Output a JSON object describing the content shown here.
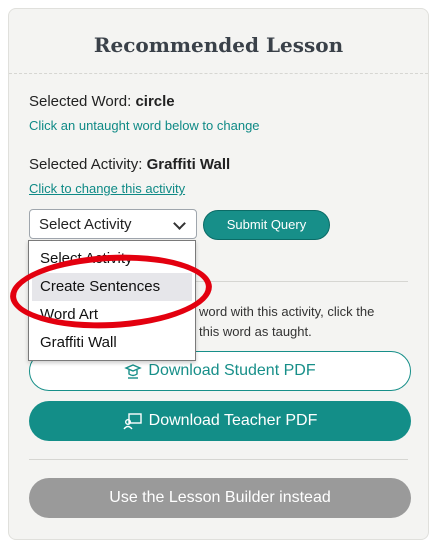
{
  "card": {
    "title": "Recommended Lesson",
    "selected_word_label": "Selected Word: ",
    "selected_word_value": "circle",
    "change_word_link": "Click an untaught word below to change",
    "selected_activity_label": "Selected Activity: ",
    "selected_activity_value": "Graffiti Wall",
    "change_activity_link": "Click to change this activity",
    "select_value": "Select Activity",
    "submit_label": "Submit Query",
    "help_line1": "word with this activity, click the",
    "help_line2": "this word as taught.",
    "download_student": "Download Student PDF",
    "download_teacher": "Download Teacher PDF",
    "lesson_builder": "Use the Lesson Builder instead"
  },
  "dropdown": {
    "options": [
      "Select Activity",
      "Create Sentences",
      "Word Art",
      "Graffiti Wall"
    ],
    "highlighted": "Create Sentences"
  },
  "colors": {
    "accent": "#178f89",
    "annotation": "#e3000f",
    "disabled": "#9a9a9a"
  },
  "icons": {
    "student": "student-icon",
    "teacher": "teacher-icon",
    "chevron": "chevron-down-icon"
  }
}
